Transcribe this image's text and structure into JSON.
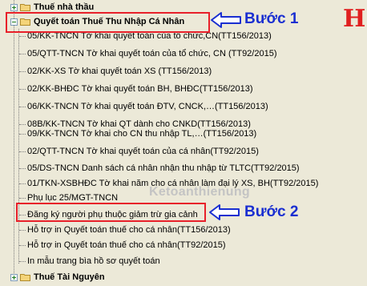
{
  "tree": {
    "parent_top": {
      "label": "Thuế nhà thầu",
      "expanded": false
    },
    "parent_open": {
      "label": "Quyết toán Thuế Thu Nhập Cá Nhân",
      "expanded": true
    },
    "children": [
      "05/KK-TNCN Tờ khai quyết toán của tổ chức,CN(TT156/2013)",
      "05/QTT-TNCN Tờ khai quyết toán của tổ chức, CN (TT92/2015)",
      "02/KK-XS Tờ khai quyết toán XS (TT156/2013)",
      "02/KK-BHĐC Tờ khai quyết toán BH, BHĐC(TT156/2013)",
      "06/KK-TNCN Tờ khai quyết toán ĐTV, CNCK,…(TT156/2013)",
      "08B/KK-TNCN Tờ khai QT dành cho CNKD(TT156/2013)",
      "09/KK-TNCN Tờ khai cho CN thu nhập TL,…(TT156/2013)",
      "02/QTT-TNCN Tờ khai quyết toán của cá nhân(TT92/2015)",
      "05/DS-TNCN Danh sách cá nhân nhận thu nhập từ TLTC(TT92/2015)",
      "01/TKN-XSBHĐC Tờ khai năm cho cá nhân làm đại lý XS, BH(TT92/2015)",
      "Phụ lục 25/MGT-TNCN",
      "Đăng ký người phụ thuộc giảm trừ gia cảnh",
      "Hỗ trợ in Quyết toán thuế cho cá nhân(TT156/2013)",
      "Hỗ trợ in Quyết toán thuế cho cá nhân(TT92/2015)",
      "In mẫu trang bìa hồ sơ quyết toán"
    ],
    "parent_bottom": {
      "label": "Thuế Tài Nguyên",
      "expanded": false
    }
  },
  "annotations": {
    "step1": "Bước 1",
    "step2": "Bước 2",
    "watermark": "Ketoanthienung"
  },
  "colors": {
    "background": "#ece9d8",
    "highlight_box": "#e8202a",
    "step_text": "#1a2fd1",
    "folder": "#e8c35a",
    "logo": "#e02020"
  },
  "icons": {
    "folder": "folder-icon",
    "expand": "plus-expander-icon",
    "collapse": "minus-expander-icon",
    "arrow": "arrow-left-icon",
    "logo": "logo-h-icon"
  }
}
